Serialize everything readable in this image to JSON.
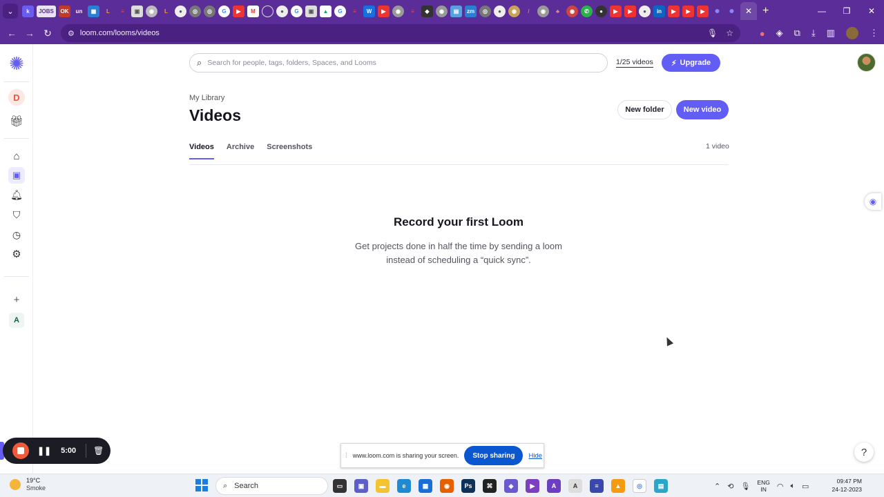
{
  "browser": {
    "jobs_tab_label": "JOBS",
    "url": "loom.com/looms/videos",
    "close_tab": "✕",
    "new_tab": "+",
    "window_controls": [
      "—",
      "❐",
      "✕"
    ]
  },
  "search": {
    "placeholder": "Search for people, tags, folders, Spaces, and Looms"
  },
  "header": {
    "video_quota": "1/25 videos",
    "upgrade_label": "Upgrade"
  },
  "sidebar": {
    "workspace_initial": "D",
    "add_label": "+",
    "workspace_a": "A"
  },
  "library": {
    "breadcrumb": "My Library",
    "title": "Videos",
    "new_folder_label": "New folder",
    "new_video_label": "New video",
    "tabs": [
      {
        "label": "Videos",
        "active": true
      },
      {
        "label": "Archive",
        "active": false
      },
      {
        "label": "Screenshots",
        "active": false
      }
    ],
    "video_count": "1 video"
  },
  "empty_state": {
    "title": "Record your first Loom",
    "text": "Get projects done in half the time by sending a loom instead of scheduling a “quick sync”."
  },
  "help_label": "?",
  "recorder": {
    "time": "5:00"
  },
  "share_bar": {
    "message": "www.loom.com is sharing your screen.",
    "stop_label": "Stop sharing",
    "hide_label": "Hide"
  },
  "taskbar": {
    "temperature": "19°C",
    "condition": "Smoke",
    "search_label": "Search",
    "language_line1": "ENG",
    "language_line2": "IN",
    "time": "09:47 PM",
    "date": "24-12-2023"
  },
  "colors": {
    "brand": "#625df5",
    "chrome_purple": "#5b2d99",
    "record_red": "#f05a38",
    "share_blue": "#0b57d0"
  }
}
